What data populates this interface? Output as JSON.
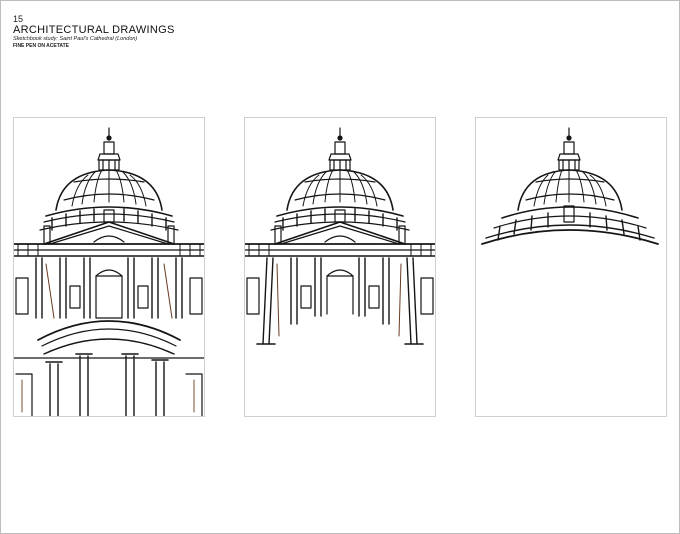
{
  "header": {
    "page_number": "15",
    "title": "ARCHITECTURAL DRAWINGS",
    "subtitle": "Sketchbook study: Saint Paul's Cathedral (London)",
    "medium": "FINE PEN ON ACETATE"
  },
  "panels": [
    {
      "id": "full-drawing",
      "stage": "full"
    },
    {
      "id": "partial-drawing",
      "stage": "dome-and-upper-facade"
    },
    {
      "id": "dome-only-drawing",
      "stage": "dome-only"
    }
  ],
  "colors": {
    "ink": "#151515",
    "ink_warm": "#6a3a22",
    "frame": "#bdbdbd"
  }
}
